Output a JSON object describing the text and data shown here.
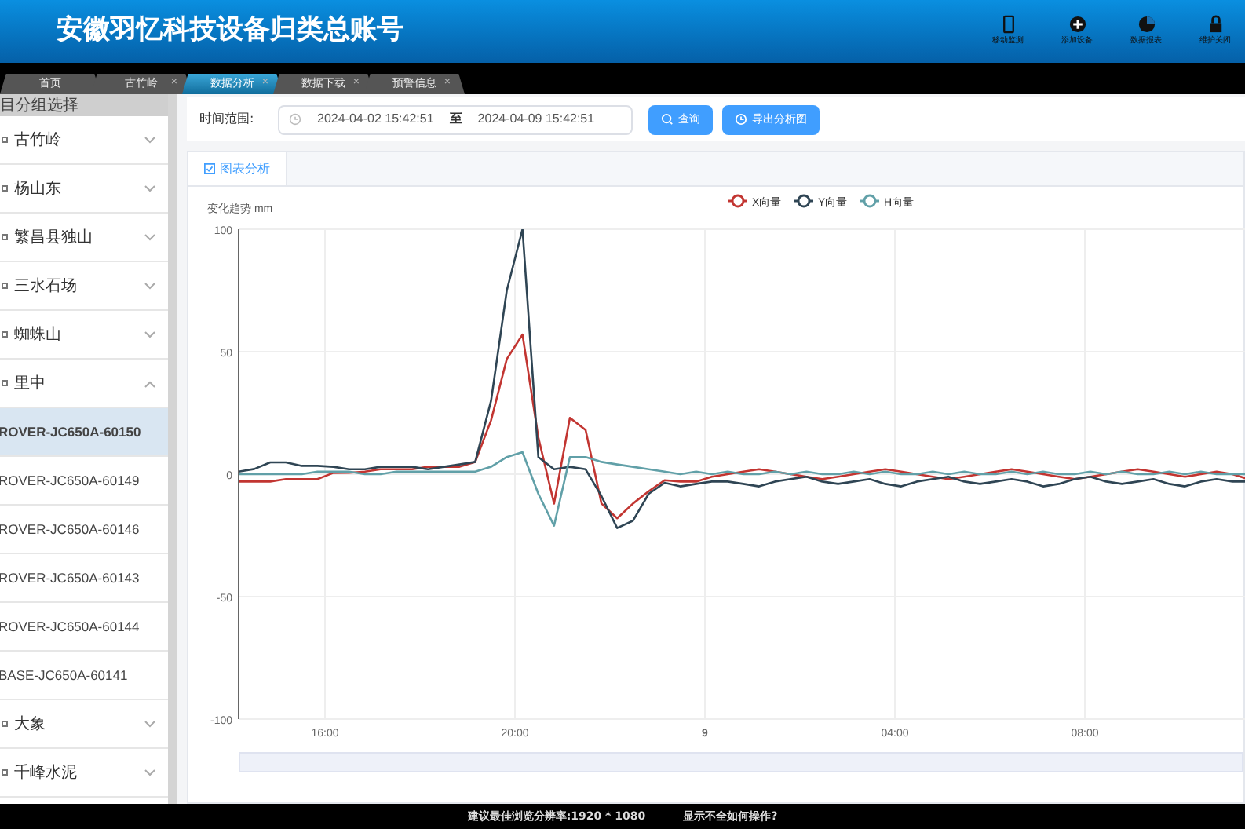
{
  "header": {
    "title": "安徽羽忆科技设备归类总账号",
    "actions": [
      {
        "kind": "phone",
        "label": "移动监测"
      },
      {
        "kind": "plus",
        "label": "添加设备"
      },
      {
        "kind": "pie",
        "label": "数据报表"
      },
      {
        "kind": "lock",
        "label": "维护关闭"
      }
    ]
  },
  "tabs": [
    {
      "label": "首页",
      "selected": false
    },
    {
      "label": "古竹岭",
      "close": "×",
      "selected": false
    },
    {
      "label": "数据分析",
      "close": "×",
      "selected": true
    },
    {
      "label": "数据下载",
      "close": "×",
      "selected": false
    },
    {
      "label": "预警信息",
      "close": "×",
      "selected": false
    }
  ],
  "sidebar": {
    "title": "目分组选择",
    "groups": [
      {
        "label": "古竹岭",
        "expanded": false
      },
      {
        "label": "杨山东",
        "expanded": false
      },
      {
        "label": "繁昌县独山",
        "expanded": false
      },
      {
        "label": "三水石场",
        "expanded": false
      },
      {
        "label": "蜘蛛山",
        "expanded": false
      },
      {
        "label": "里中",
        "expanded": true,
        "children": [
          {
            "label": "ROVER-JC650A-60150",
            "selected": true
          },
          {
            "label": "ROVER-JC650A-60149",
            "selected": false
          },
          {
            "label": "ROVER-JC650A-60146",
            "selected": false
          },
          {
            "label": "ROVER-JC650A-60143",
            "selected": false
          },
          {
            "label": "ROVER-JC650A-60144",
            "selected": false
          },
          {
            "label": "BASE-JC650A-60141",
            "selected": false
          }
        ]
      },
      {
        "label": "大象",
        "expanded": false
      },
      {
        "label": "千峰水泥",
        "expanded": false
      }
    ]
  },
  "filter": {
    "label": "时间范围:",
    "start": "2024-04-02 15:42:51",
    "separator": "至",
    "end": "2024-04-09 15:42:51",
    "buttons": [
      {
        "kind": "search",
        "label": "查询"
      },
      {
        "kind": "export",
        "label": "导出分析图"
      }
    ]
  },
  "panel": {
    "tab": "图表分析",
    "zoom_slider": {
      "level": 1
    },
    "x_axis_labels": [
      "16:00",
      "20:00",
      "9",
      "04:00",
      "08:00"
    ],
    "chart_data": {
      "type": "line",
      "ylabel": "变化趋势 mm",
      "grid": true,
      "legend": true,
      "ylim": [
        -100,
        100
      ],
      "yticks": [
        -100,
        -50,
        0,
        50,
        100
      ],
      "series": [
        {
          "name": "X向量",
          "color": "#c23531",
          "values": [
            -3,
            -3,
            -3,
            -2,
            -2,
            -2,
            0.5,
            0.6,
            1,
            2,
            2,
            2,
            3,
            3,
            3,
            5,
            22,
            47,
            57,
            15,
            -12,
            23,
            18,
            -12,
            -18,
            -12,
            -7,
            -2.5,
            -3,
            -3,
            -1,
            0,
            1,
            2,
            1,
            0,
            -1,
            -2,
            -1,
            0,
            1,
            2,
            1,
            0,
            -1,
            -2,
            -1,
            0,
            1,
            2,
            1,
            0,
            -1,
            -2,
            -1,
            0,
            1,
            2,
            1,
            0,
            -1,
            0,
            1,
            0,
            -2
          ]
        },
        {
          "name": "Y向量",
          "color": "#2f4554",
          "values": [
            1,
            2.1,
            4.8,
            4.8,
            3.4,
            3.4,
            3,
            2,
            2,
            3,
            3,
            3,
            2,
            3,
            4,
            5,
            30,
            75,
            100,
            7,
            2,
            3,
            2,
            -9,
            -22,
            -19,
            -8,
            -3.5,
            -5,
            -4,
            -3,
            -3,
            -4,
            -5,
            -3,
            -2,
            -1,
            -3,
            -4,
            -3,
            -2,
            -4,
            -5,
            -3,
            -2,
            -1,
            -3,
            -4,
            -3,
            -2,
            -3,
            -5,
            -4,
            -2,
            -1,
            -3,
            -4,
            -3,
            -2,
            -4,
            -5,
            -3,
            -2,
            -3,
            -3
          ]
        },
        {
          "name": "H向量",
          "color": "#61a0a8",
          "values": [
            0,
            0,
            0,
            0,
            0,
            1,
            1,
            1,
            0,
            0,
            1,
            1,
            1,
            1,
            1,
            1,
            3,
            7,
            9,
            -8,
            -21,
            7,
            7,
            5,
            4,
            3,
            2,
            1,
            0,
            1,
            0,
            1,
            0,
            0,
            1,
            0,
            1,
            0,
            0,
            1,
            0,
            1,
            0,
            0,
            1,
            0,
            1,
            0,
            0,
            1,
            0,
            1,
            0,
            0,
            1,
            0,
            1,
            0,
            0,
            1,
            0,
            1,
            0,
            0,
            0
          ]
        }
      ]
    }
  },
  "footer": {
    "resolution": "建议最佳浏览分辨率:1920 * 1080",
    "help": "显示不全如何操作?"
  }
}
